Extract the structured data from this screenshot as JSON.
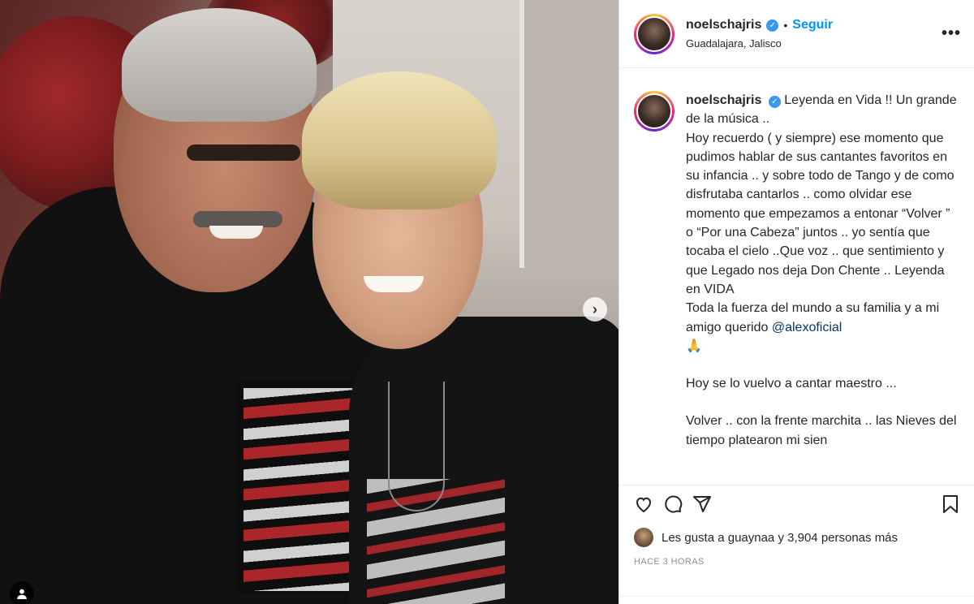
{
  "post": {
    "username": "noelschajris",
    "follow_label": "Seguir",
    "separator": "•",
    "location": "Guadalajara, Jalisco",
    "more_label": "•••"
  },
  "caption": {
    "username": "noelschajris",
    "paragraphs": [
      "Leyenda en Vida !! Un grande de la música ..",
      "Hoy recuerdo ( y siempre) ese momento que pudimos hablar de sus cantantes favoritos en su infancia .. y sobre todo de Tango y de como disfrutaba cantarlos .. como olvidar ese momento que empezamos a entonar “Volver ” o “Por una Cabeza” juntos .. yo sentía que tocaba el cielo ..Que voz .. que sentimiento y que Legado nos deja Don Chente .. Leyenda en VIDA",
      "Toda la fuerza del mundo a su familia y a mi amigo querido"
    ],
    "mention": "@alexoficial",
    "emoji": "🙏",
    "paragraph_after_1": "Hoy se lo vuelvo a cantar maestro ...",
    "paragraph_after_2": "Volver .. con la frente marchita .. las Nieves del tiempo platearon mi sien"
  },
  "likes": {
    "text": "Les gusta a guaynaa y 3,904 personas más"
  },
  "timestamp": "HACE 3 HORAS",
  "icons": {
    "like": "heart-icon",
    "comment": "comment-icon",
    "share": "share-icon",
    "save": "bookmark-icon",
    "next": "chevron-right-icon",
    "tag": "user-tag-icon"
  },
  "colors": {
    "accent": "#0095f6",
    "verified": "#3897f0",
    "mention": "#00376b"
  }
}
